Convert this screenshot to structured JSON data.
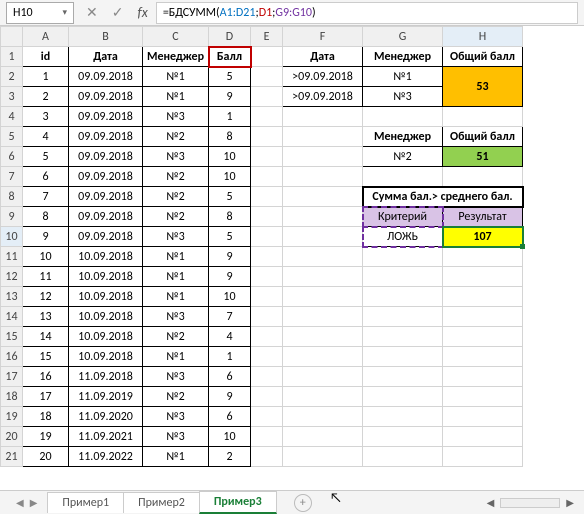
{
  "name_box": "H10",
  "formula": {
    "prefix": "=БДСУММ(",
    "ref1": "A1:D21",
    "sep1": ";",
    "ref2": "D1",
    "sep2": ";",
    "ref3": "G9:G10",
    "suffix": ")"
  },
  "cols": [
    "A",
    "B",
    "C",
    "D",
    "E",
    "F",
    "G",
    "H"
  ],
  "table1": {
    "headers": [
      "id",
      "Дата",
      "Менеджер",
      "Балл"
    ],
    "rows": [
      [
        "1",
        "09.09.2018",
        "№1",
        "5"
      ],
      [
        "2",
        "09.09.2018",
        "№1",
        "9"
      ],
      [
        "3",
        "09.09.2018",
        "№3",
        "1"
      ],
      [
        "4",
        "09.09.2018",
        "№2",
        "8"
      ],
      [
        "5",
        "09.09.2018",
        "№3",
        "10"
      ],
      [
        "6",
        "09.09.2018",
        "№2",
        "10"
      ],
      [
        "7",
        "09.09.2018",
        "№2",
        "5"
      ],
      [
        "8",
        "09.09.2018",
        "№2",
        "8"
      ],
      [
        "9",
        "09.09.2018",
        "№3",
        "5"
      ],
      [
        "10",
        "10.09.2018",
        "№1",
        "9"
      ],
      [
        "11",
        "10.09.2018",
        "№1",
        "9"
      ],
      [
        "12",
        "10.09.2018",
        "№1",
        "10"
      ],
      [
        "13",
        "10.09.2018",
        "№3",
        "7"
      ],
      [
        "14",
        "10.09.2018",
        "№2",
        "4"
      ],
      [
        "15",
        "10.09.2018",
        "№1",
        "1"
      ],
      [
        "16",
        "11.09.2018",
        "№3",
        "6"
      ],
      [
        "17",
        "11.09.2019",
        "№2",
        "9"
      ],
      [
        "18",
        "11.09.2020",
        "№3",
        "6"
      ],
      [
        "19",
        "11.09.2021",
        "№3",
        "10"
      ],
      [
        "20",
        "11.09.2022",
        "№1",
        "2"
      ]
    ]
  },
  "crit1": {
    "headers": [
      "Дата",
      "Менеджер",
      "Общий балл"
    ],
    "r1": [
      ">09.09.2018",
      "№1"
    ],
    "r2": [
      ">09.09.2018",
      "№3"
    ],
    "result": "53"
  },
  "crit2": {
    "headers": [
      "Менеджер",
      "Общий балл"
    ],
    "r1": [
      "№2"
    ],
    "result": "51"
  },
  "crit3": {
    "title": "Сумма бал.> среднего бал.",
    "h1": "Критерий",
    "h2": "Результат",
    "v1": "ЛОЖЬ",
    "v2": "107"
  },
  "tabs": [
    "Пример1",
    "Пример2",
    "Пример3"
  ],
  "active_tab": 2
}
